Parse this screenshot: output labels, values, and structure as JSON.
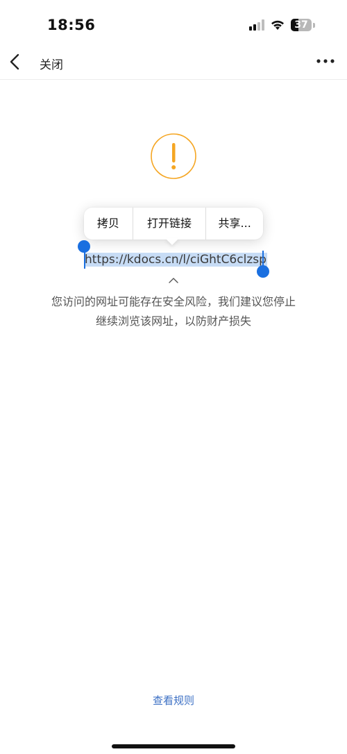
{
  "status_bar": {
    "time": "18:56",
    "battery_level": "37",
    "icons": [
      "cellular-signal-icon",
      "wifi-icon",
      "battery-icon"
    ]
  },
  "nav": {
    "back_icon": "chevron-left-icon",
    "close_label": "关闭",
    "more_icon": "more-horizontal-icon"
  },
  "warning": {
    "icon": "exclamation-circle-icon",
    "icon_color": "#f5a623",
    "url": "https://kdocs.cn/l/ciGhtC6clzsp",
    "message_line1": "您访问的网址可能存在安全风险，我们建议您停止",
    "message_line2": "继续浏览该网址，以防财产损失"
  },
  "context_menu": {
    "copy": "拷贝",
    "open_link": "打开链接",
    "share": "共享..."
  },
  "footer": {
    "rules_link": "查看规则",
    "link_color": "#3b6fc4"
  },
  "selection_color": "#1a6fe0"
}
